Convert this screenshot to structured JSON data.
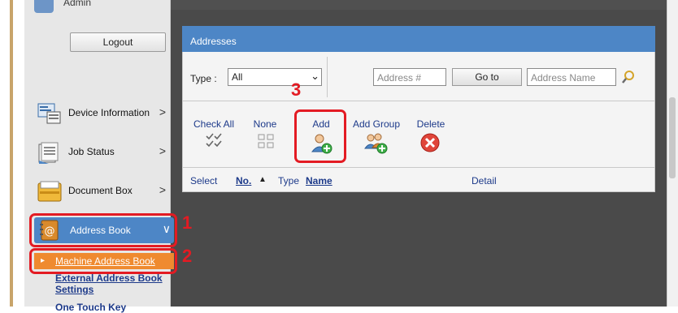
{
  "sidebar": {
    "user_name": "Admin",
    "logout_label": "Logout",
    "items": [
      {
        "label": "Device Information",
        "arrow": ">"
      },
      {
        "label": "Job Status",
        "arrow": ">"
      },
      {
        "label": "Document Box",
        "arrow": ">"
      }
    ],
    "address_book": {
      "label": "Address Book",
      "arrow": "∨"
    },
    "machine_address_book": "Machine Address Book",
    "external_address_book": "External Address Book Settings",
    "next_item_partial": "One Touch Key"
  },
  "panel": {
    "title": "Addresses",
    "type_label": "Type :",
    "type_value": "All",
    "address_number_placeholder": "Address #",
    "goto_label": "Go to",
    "address_name_placeholder": "Address Name",
    "tools": {
      "check_all": "Check All",
      "none": "None",
      "add": "Add",
      "add_group": "Add Group",
      "delete": "Delete"
    },
    "columns": {
      "select": "Select",
      "number": "No.",
      "sort_indicator": "▲",
      "type": "Type",
      "name": "Name",
      "detail": "Detail"
    }
  },
  "callouts": {
    "one": "1",
    "two": "2",
    "three": "3"
  },
  "colors": {
    "accent_blue": "#4d86c6",
    "highlight_orange": "#ef8a2f",
    "callout_red": "#e31b23",
    "background_dark": "#4a4a4a"
  }
}
